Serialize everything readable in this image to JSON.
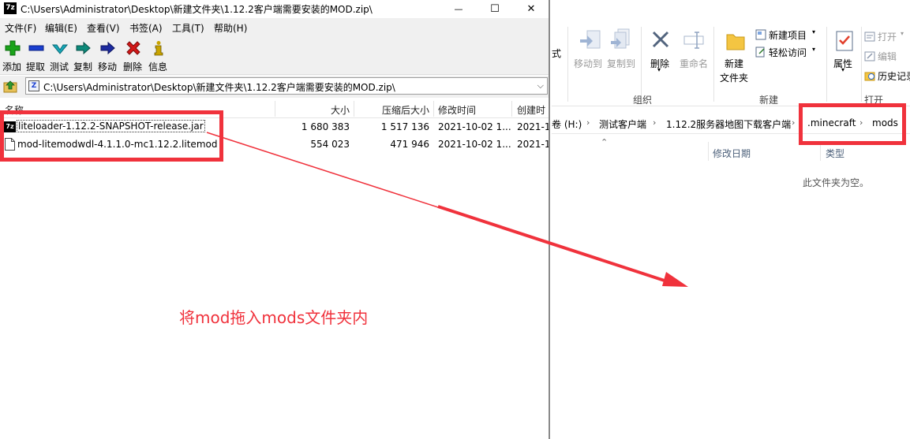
{
  "sevenzip": {
    "title": "C:\\Users\\Administrator\\Desktop\\新建文件夹\\1.12.2客户端需要安装的MOD.zip\\",
    "app_icon": "7z",
    "controls": {
      "minimize": "—",
      "maximize": "☐",
      "close": "✕"
    },
    "menu": [
      "文件(F)",
      "编辑(E)",
      "查看(V)",
      "书签(A)",
      "工具(T)",
      "帮助(H)"
    ],
    "toolbar": [
      {
        "label": "添加",
        "icon": "plus-icon",
        "color": "#1aa31a"
      },
      {
        "label": "提取",
        "icon": "minus-icon",
        "color": "#1a3fd0"
      },
      {
        "label": "测试",
        "icon": "check-icon",
        "color": "#18a8b8"
      },
      {
        "label": "复制",
        "icon": "copy-arrow-icon",
        "color": "#0c8a7a"
      },
      {
        "label": "移动",
        "icon": "move-arrow-icon",
        "color": "#1c2aa0"
      },
      {
        "label": "删除",
        "icon": "x-icon",
        "color": "#d31818"
      },
      {
        "label": "信息",
        "icon": "info-icon",
        "color": "#c9a400"
      }
    ],
    "address": "C:\\Users\\Administrator\\Desktop\\新建文件夹\\1.12.2客户端需要安装的MOD.zip\\",
    "columns": [
      "名称",
      "大小",
      "压缩后大小",
      "修改时间",
      "创建时"
    ],
    "files": [
      {
        "name": "liteloader-1.12.2-SNAPSHOT-release.jar",
        "icon": "7z",
        "size": "1 680 383",
        "packed": "1 517 136",
        "modified": "2021-10-02 1...",
        "created": "2021-1"
      },
      {
        "name": "mod-litemodwdl-4.1.1.0-mc1.12.2.litemod",
        "icon": "file",
        "size": "554 023",
        "packed": "471 946",
        "modified": "2021-10-02 1...",
        "created": "2021-1"
      }
    ]
  },
  "explorer": {
    "ribbon": {
      "partial_left": "式",
      "move_to": "移动到",
      "copy_to": "复制到",
      "delete": "删除",
      "rename": "重命名",
      "new_folder": "新建",
      "new_folder_2": "文件夹",
      "new_item": "新建项目",
      "easy_access": "轻松访问",
      "properties": "属性",
      "open": "打开",
      "edit": "编辑",
      "history": "历史记录",
      "group_organize": "组织",
      "group_new": "新建",
      "group_open": "打开"
    },
    "breadcrumb": [
      "卷 (H:)",
      "测试客户端",
      "1.12.2服务器地图下载客户端",
      ".minecraft",
      "mods"
    ],
    "columns": {
      "modified": "修改日期",
      "type": "类型"
    },
    "empty_message": "此文件夹为空。"
  },
  "annotation": {
    "text": "将mod拖入mods文件夹内",
    "color": "#f0323c"
  }
}
